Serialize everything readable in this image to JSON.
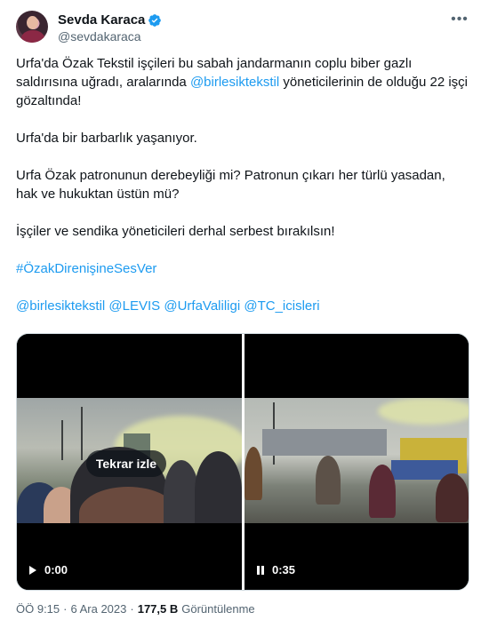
{
  "author": {
    "name": "Sevda Karaca",
    "handle": "@sevdakaraca",
    "verified": true,
    "verified_color": "#1d9bf0"
  },
  "more_icon": "more-dots-icon",
  "tweet": {
    "p1_a": "Urfa'da Özak Tekstil işçileri bu sabah jandarmanın coplu biber gazlı saldırısına uğradı, aralarında ",
    "p1_mention": "@birlesiktekstil",
    "p1_b": " yöneticilerinin de olduğu 22 işçi gözaltında!",
    "p2": "Urfa'da bir barbarlık yaşanıyor.",
    "p3": "Urfa Özak patronunun derebeyliği mi? Patronun çıkarı her türlü yasadan, hak ve hukuktan üstün mü?",
    "p4": "İşçiler ve sendika yöneticileri derhal serbest bırakılsın!",
    "hashtag": "#ÖzakDirenişineSesVer",
    "mentions": [
      "@birlesiktekstil",
      "@LEVIS",
      "@UrfaValiligi",
      "@TC_icisleri"
    ]
  },
  "media": {
    "left": {
      "replay_label": "Tekrar izle",
      "time": "0:00",
      "state": "play"
    },
    "right": {
      "time": "0:35",
      "state": "pause"
    }
  },
  "meta": {
    "time": "ÖÖ 9:15",
    "date": "6 Ara 2023",
    "views": "177,5 B",
    "views_label": "Görüntülenme"
  },
  "colors": {
    "link": "#1d9bf0",
    "secondary_text": "#536471"
  }
}
